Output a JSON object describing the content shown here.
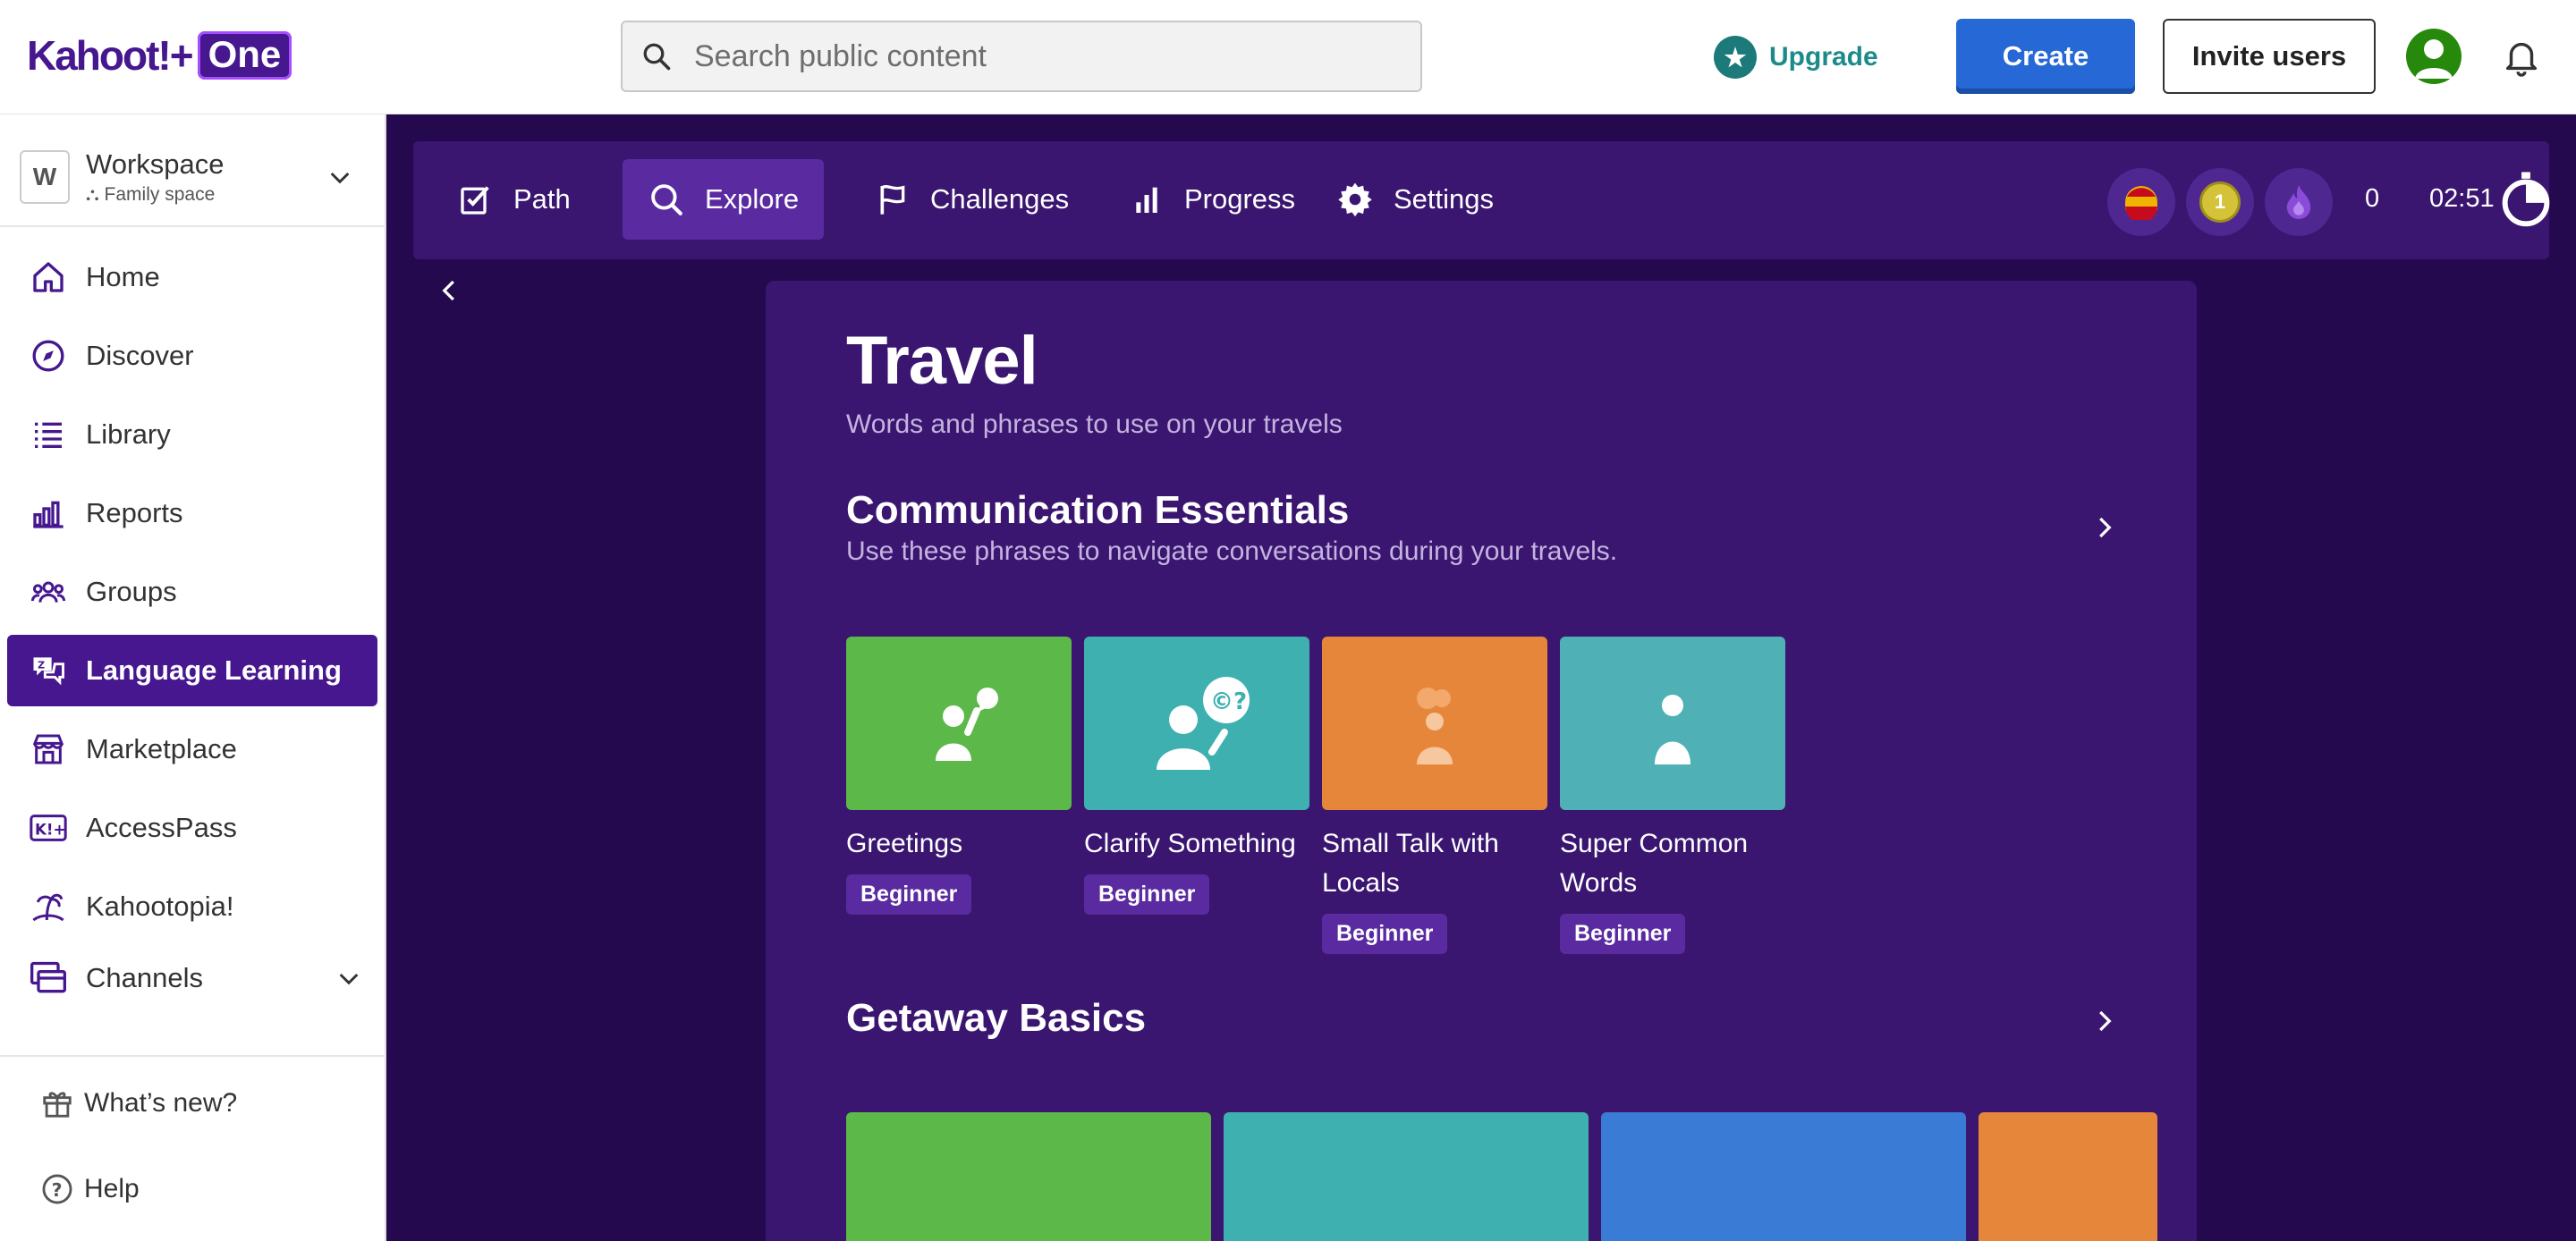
{
  "topbar": {
    "logo_main": "Kahoot!+",
    "logo_badge": "One",
    "search_placeholder": "Search public content",
    "upgrade_label": "Upgrade",
    "create_label": "Create",
    "invite_label": "Invite users"
  },
  "sidebar": {
    "workspace": {
      "initial": "W",
      "name": "Workspace",
      "sub": "Family space"
    },
    "items": [
      {
        "label": "Home",
        "icon": "home-icon"
      },
      {
        "label": "Discover",
        "icon": "compass-icon"
      },
      {
        "label": "Library",
        "icon": "list-icon"
      },
      {
        "label": "Reports",
        "icon": "bar-chart-icon"
      },
      {
        "label": "Groups",
        "icon": "groups-icon"
      },
      {
        "label": "Language Learning",
        "icon": "language-icon",
        "active": true
      },
      {
        "label": "Marketplace",
        "icon": "store-icon"
      },
      {
        "label": "AccessPass",
        "icon": "accesspass-icon"
      },
      {
        "label": "Kahootopia!",
        "icon": "island-icon"
      },
      {
        "label": "Channels",
        "icon": "channels-icon"
      }
    ],
    "footer": [
      {
        "label": "What’s new?",
        "icon": "gift-icon"
      },
      {
        "label": "Help",
        "icon": "help-icon"
      }
    ]
  },
  "tabs": [
    {
      "label": "Path",
      "icon": "path-icon"
    },
    {
      "label": "Explore",
      "icon": "search-icon",
      "active": true
    },
    {
      "label": "Challenges",
      "icon": "flag-icon"
    },
    {
      "label": "Progress",
      "icon": "progress-icon"
    },
    {
      "label": "Settings",
      "icon": "gear-icon"
    }
  ],
  "stats": {
    "streak": "0",
    "timer": "02:51",
    "level_badge": "1"
  },
  "content": {
    "title": "Travel",
    "subtitle": "Words and phrases to use on your travels",
    "sections": [
      {
        "title": "Communication Essentials",
        "subtitle": "Use these phrases to navigate conversations during your travels.",
        "cards": [
          {
            "title": "Greetings",
            "level": "Beginner",
            "color": "#5cb849"
          },
          {
            "title": "Clarify Something",
            "level": "Beginner",
            "color": "#3eb0b0"
          },
          {
            "title": "Small Talk with Locals",
            "level": "Beginner",
            "color": "#e6863a"
          },
          {
            "title": "Super Common Words",
            "level": "Beginner",
            "color": "#4fb1b5"
          }
        ]
      },
      {
        "title": "Getaway Basics",
        "cards": [
          {
            "color": "#5cb849"
          },
          {
            "color": "#3eb0b0"
          },
          {
            "color": "#3a7bd5"
          },
          {
            "color": "#e6863a"
          }
        ]
      }
    ]
  },
  "colors": {
    "brand": "#46178f",
    "main_bg": "#25094f",
    "panel_bg": "#3a1670",
    "create_blue": "#2668d5"
  }
}
